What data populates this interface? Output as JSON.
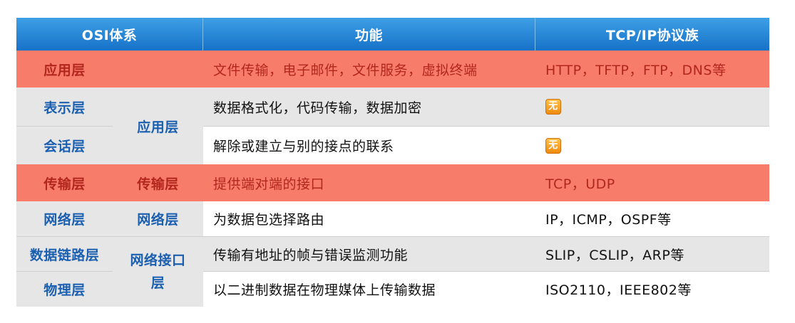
{
  "headers": {
    "osi": "OSI体系",
    "function": "功能",
    "tcpip": "TCP/IP协议族"
  },
  "rows": [
    {
      "osi_layer": "应用层",
      "function": "文件传输，电子邮件，文件服务，虚拟终端",
      "protocols": "HTTP，TFTP，FTP，DNS等"
    },
    {
      "osi_layer": "表示层",
      "function": "数据格式化，代码传输，数据加密",
      "protocols_icon": "无",
      "icon_name": "no-icon"
    },
    {
      "osi_layer": "会话层",
      "function": "解除或建立与别的接点的联系",
      "protocols_icon": "无",
      "icon_name": "no-icon"
    },
    {
      "osi_layer": "传输层",
      "function": "提供端对端的接口",
      "protocols": "TCP，UDP"
    },
    {
      "osi_layer": "网络层",
      "function": "为数据包选择路由",
      "protocols": "IP，ICMP，OSPF等"
    },
    {
      "osi_layer": "数据链路层",
      "function": "传输有地址的帧与错误监测功能",
      "protocols": "SLIP，CSLIP，ARP等"
    },
    {
      "osi_layer": "物理层",
      "function": "以二进制数据在物理媒体上传输数据",
      "protocols": "ISO2110，IEEE802等"
    }
  ],
  "tcpip_layers": {
    "application": "应用层",
    "transport": "传输层",
    "network": "网络层",
    "link_line1": "网络接口",
    "link_line2": "层"
  },
  "colors": {
    "header_top": "#3e9fe6",
    "header_bottom": "#1672c8",
    "highlight_row": "#f77d6a",
    "highlight_text": "#b3261e",
    "layer_text": "#1b5fb0",
    "row_gray": "#e6e6e6",
    "row_white": "#ffffff",
    "no_icon": "#f5a020"
  }
}
